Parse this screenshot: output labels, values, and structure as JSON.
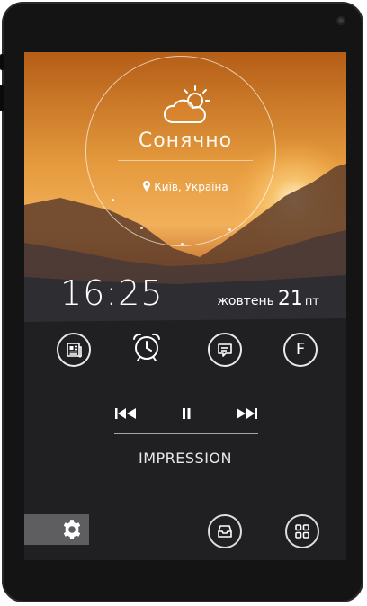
{
  "weather": {
    "condition": "Сонячно",
    "location": "Київ, Україна",
    "icon": "partly-cloudy-icon"
  },
  "clock": {
    "time": "16:25",
    "month": "жовтень",
    "day": "21",
    "weekday": "пт"
  },
  "shortcuts": [
    {
      "icon": "newspaper-icon"
    },
    {
      "icon": "alarm-clock-icon"
    },
    {
      "icon": "message-icon"
    },
    {
      "icon": "facebook-icon",
      "letter": "F"
    }
  ],
  "music": {
    "title": "IMPRESSION",
    "controls": [
      "previous-icon",
      "pause-icon",
      "next-icon"
    ]
  },
  "dock": {
    "left": "gear-icon",
    "middle": "inbox-icon",
    "right": "apps-grid-icon"
  }
}
